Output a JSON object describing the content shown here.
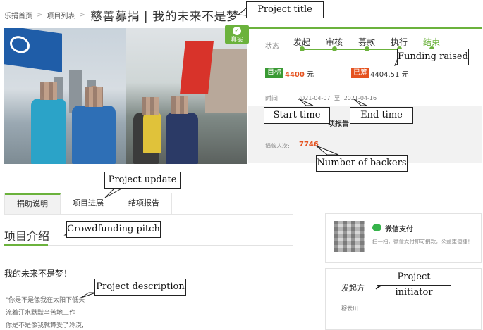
{
  "breadcrumb": {
    "home": "乐捐首页",
    "list": "项目列表",
    "separator": ">"
  },
  "page_title": "慈善募捐 | 我的未来不是梦",
  "hero": {
    "real_badge": "真实"
  },
  "status": {
    "label": "状态",
    "steps": [
      "发起",
      "审核",
      "募款",
      "执行",
      "结束"
    ]
  },
  "funding": {
    "goal_tag": "目标",
    "goal_amount": "4400",
    "goal_unit": "元",
    "raised_tag": "已筹",
    "raised_amount": "4404.51",
    "raised_unit": "元"
  },
  "time": {
    "label": "时间",
    "start": "2021-04-07",
    "to": "至",
    "end": "2021-04-16"
  },
  "report_label": "项报告",
  "backers": {
    "label": "捐款人次:",
    "count": "7746"
  },
  "tabs": [
    "捐助说明",
    "项目进展",
    "结项报告"
  ],
  "section_title": "项目介绍",
  "story": {
    "title": "我的未来不是梦！",
    "lines": [
      "\"你是不是像我在太阳下低头",
      "流着汗水默默辛苦地工作",
      "你是不是像我就算受了冷漠,"
    ]
  },
  "pay": {
    "title": "微信支付",
    "desc": "扫一扫，微信支付即可捐款，公益更便捷！"
  },
  "initiator": {
    "title": "发起方",
    "name": "穆云川"
  },
  "callouts": {
    "project_title": "Project title",
    "funding_raised": "Funding raised",
    "start_time": "Start time",
    "end_time": "End time",
    "number_of_backers": "Number of backers",
    "project_update": "Project update",
    "crowdfunding_pitch": "Crowdfunding pitch",
    "project_description": "Project description",
    "project_initiator": "Project initiator"
  },
  "colors": {
    "accent_green": "#6bb23c",
    "highlight_orange": "#e5521f",
    "panel_grey": "#f2f2f2"
  }
}
